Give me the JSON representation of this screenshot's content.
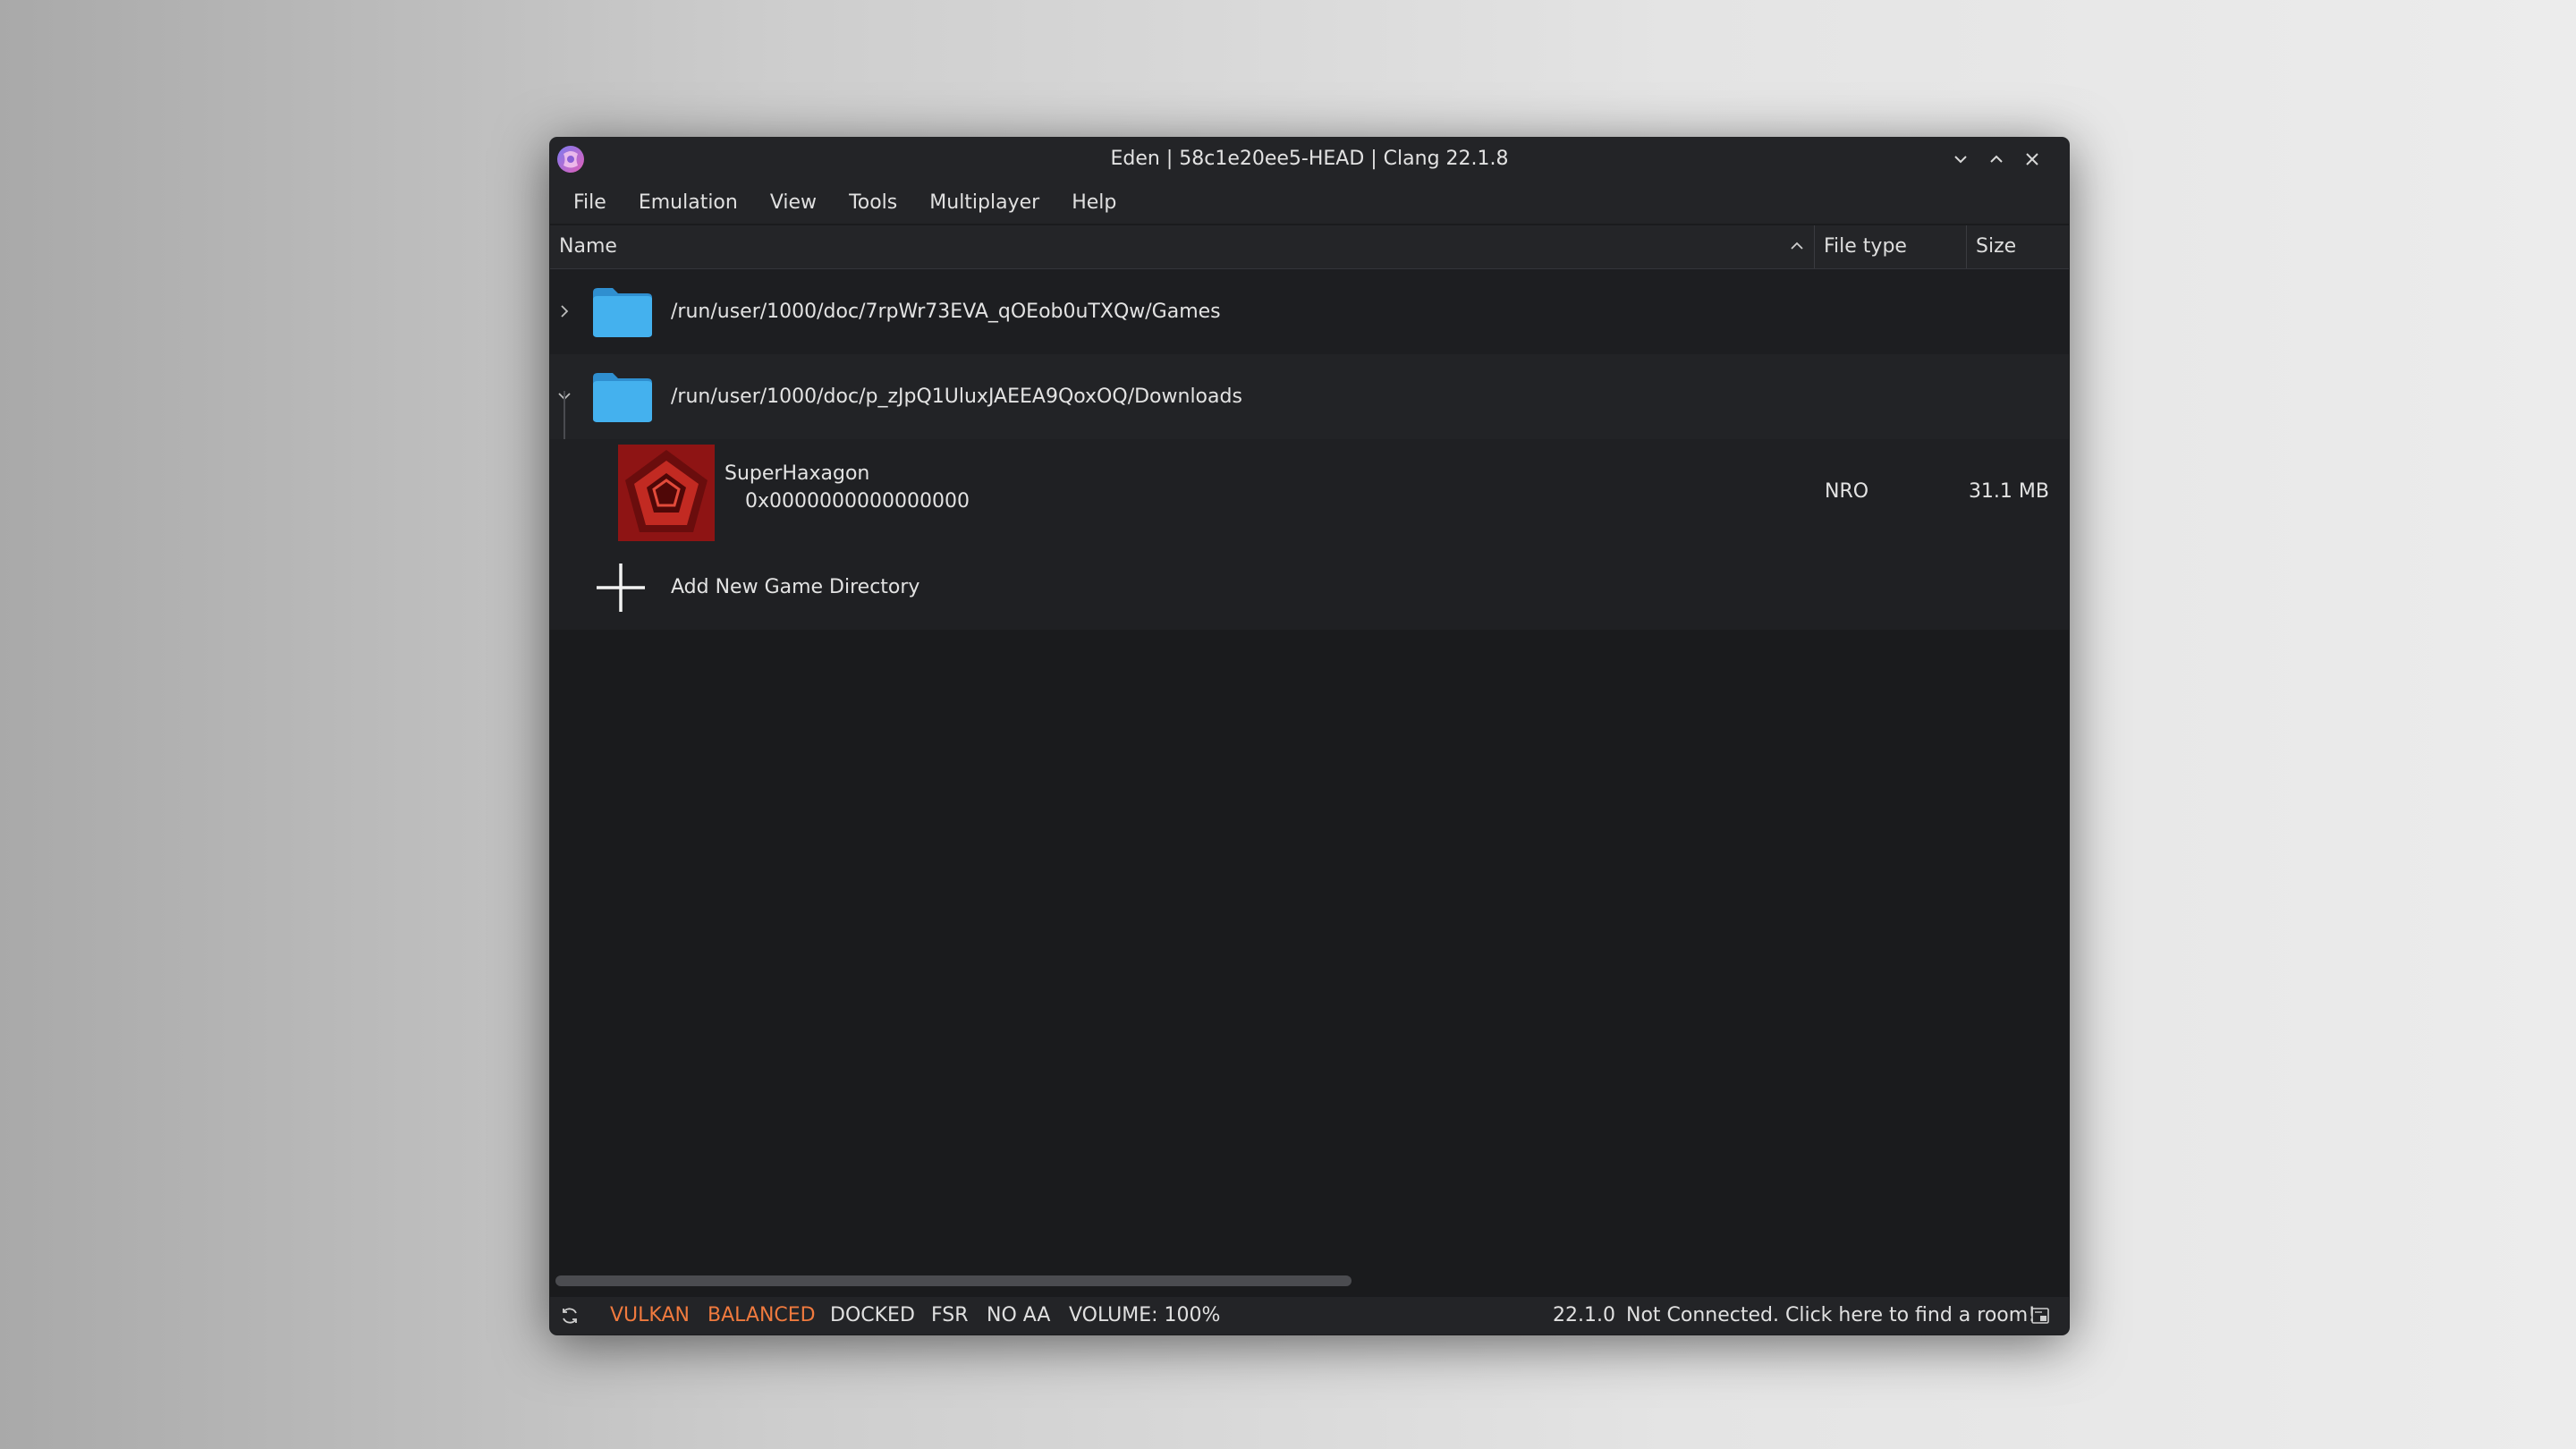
{
  "window": {
    "title": "Eden | 58c1e20ee5-HEAD | Clang 22.1.8",
    "logo_icon": "eden-logo-icon",
    "controls": [
      "minimize-icon",
      "maximize-icon",
      "close-icon"
    ]
  },
  "menu": {
    "items": [
      {
        "label": "File"
      },
      {
        "label": "Emulation"
      },
      {
        "label": "View"
      },
      {
        "label": "Tools"
      },
      {
        "label": "Multiplayer"
      },
      {
        "label": "Help"
      }
    ]
  },
  "table": {
    "columns": [
      {
        "label": "Name",
        "sort": "ascending"
      },
      {
        "label": "File type"
      },
      {
        "label": "Size"
      }
    ],
    "directories": [
      {
        "path": "/run/user/1000/doc/7rpWr73EVA_qOEob0uTXQw/Games",
        "expanded": false,
        "icon": "folder-icon"
      },
      {
        "path": "/run/user/1000/doc/p_zJpQ1UluxJAEEA9QoxOQ/Downloads",
        "expanded": true,
        "icon": "folder-icon"
      }
    ],
    "game": {
      "title": "SuperHaxagon",
      "title_id": "0x0000000000000000",
      "file_type": "NRO",
      "size": "31.1 MB",
      "icon": "super-haxagon-icon"
    },
    "add_directory": {
      "label": "Add New Game Directory",
      "icon": "plus-icon"
    }
  },
  "statusbar": {
    "refresh_icon": "refresh-icon",
    "api": "VULKAN",
    "gpu_accuracy": "BALANCED",
    "dock_mode": "DOCKED",
    "filter": "FSR",
    "aa": "NO AA",
    "volume": "VOLUME: 100%",
    "firmware": "22.1.0",
    "multiplayer_status": "Not Connected. Click here to find a room!",
    "room_icon": "room-icon"
  },
  "colors": {
    "accent_orange": "#f07a3e",
    "folder_blue": "#3ea8e6",
    "background": "#1a1b1d"
  }
}
